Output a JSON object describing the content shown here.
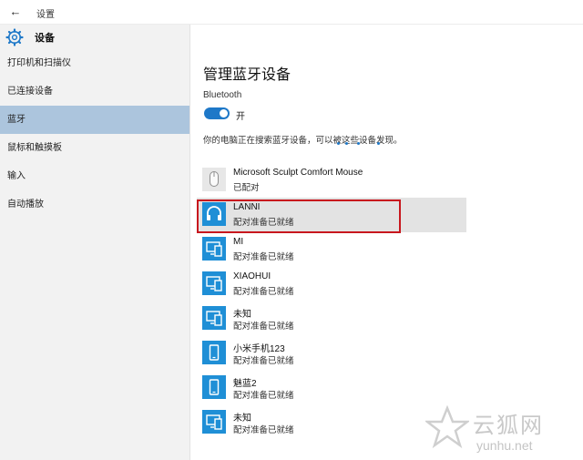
{
  "window": {
    "title": "设置",
    "back_glyph": "←"
  },
  "sidebar": {
    "header": "设备",
    "items": [
      {
        "label": "打印机和扫描仪",
        "active": false
      },
      {
        "label": "已连接设备",
        "active": false
      },
      {
        "label": "蓝牙",
        "active": true
      },
      {
        "label": "鼠标和触摸板",
        "active": false
      },
      {
        "label": "输入",
        "active": false
      },
      {
        "label": "自动播放",
        "active": false
      }
    ]
  },
  "main": {
    "title": "管理蓝牙设备",
    "bluetooth_label": "Bluetooth",
    "toggle_state": "开",
    "searching_text": "你的电脑正在搜索蓝牙设备，可以被这些设备发现。",
    "devices": [
      {
        "name": "Microsoft Sculpt Comfort Mouse",
        "status": "已配对",
        "icon": "mouse-icon"
      },
      {
        "name": "LANNI",
        "status": "配对准备已就绪",
        "icon": "headset-icon"
      },
      {
        "name": "MI",
        "status": "配对准备已就绪",
        "icon": "devices-icon"
      },
      {
        "name": "XIAOHUI",
        "status": "配对准备已就绪",
        "icon": "devices-icon"
      },
      {
        "name": "未知",
        "status": "配对准备已就绪",
        "icon": "devices-icon"
      },
      {
        "name": "小米手机123",
        "status": "配对准备已就绪",
        "icon": "phone-icon"
      },
      {
        "name": "魅蓝2",
        "status": "配对准备已就绪",
        "icon": "phone-icon"
      },
      {
        "name": "未知",
        "status": "配对准备已就绪",
        "icon": "devices-icon"
      }
    ]
  },
  "watermark": {
    "brand": "云狐网",
    "url": "yunhu.net"
  },
  "colors": {
    "accent": "#1e78c8",
    "sidebar_active": "#acc5dd",
    "highlight": "#c8171e"
  }
}
